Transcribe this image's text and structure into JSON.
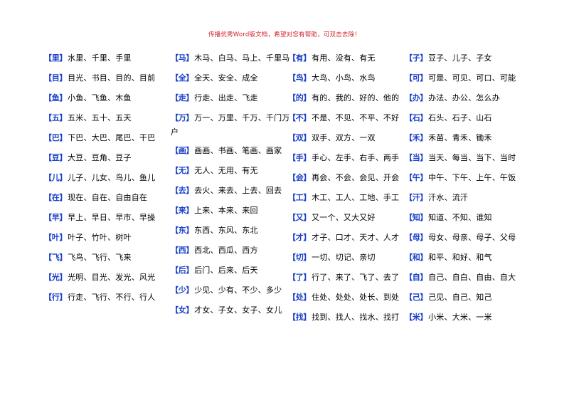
{
  "header": {
    "watermark_text": "传播优秀Word版文档，希望对您有帮助，可双击去除！",
    "watermark_color": "#d2232a"
  },
  "theme": {
    "headword_color": "#1a40c8",
    "body_text_color": "#000000",
    "background_color": "#ffffff"
  },
  "columns": [
    {
      "index": 0,
      "entries": [
        {
          "headword": "【里】",
          "words": "水里、千里、手里"
        },
        {
          "headword": "【目】",
          "words": "目光、书目、目的、目前"
        },
        {
          "headword": "【鱼】",
          "words": "小鱼、飞鱼、木鱼"
        },
        {
          "headword": "【五】",
          "words": "五米、五十、五天"
        },
        {
          "headword": "【巴】",
          "words": "下巴、大巴、尾巴、干巴"
        },
        {
          "headword": "【豆】",
          "words": "大豆、豆角、豆子"
        },
        {
          "headword": "【儿】",
          "words": "儿子、儿女、鸟儿、鱼儿"
        },
        {
          "headword": "【在】",
          "words": "现在、自在、自由自在"
        },
        {
          "headword": "【早】",
          "words": "早上、早日、早市、早操"
        },
        {
          "headword": "【叶】",
          "words": "叶子、竹叶、树叶"
        },
        {
          "headword": "【飞】",
          "words": "飞鸟、飞行、飞来"
        },
        {
          "headword": "【光】",
          "words": "光明、目光、发光、风光"
        },
        {
          "headword": "【行】",
          "words": "行走、飞行、不行、行人"
        }
      ]
    },
    {
      "index": 1,
      "entries": [
        {
          "headword": "【马】",
          "words": "木马、白马、马上、千里马"
        },
        {
          "headword": "【全】",
          "words": "全天、安全、成全"
        },
        {
          "headword": "【走】",
          "words": "行走、出走、飞走"
        },
        {
          "headword": "【万】",
          "words": "万一、万里、千万、千门万户",
          "wrap": true
        },
        {
          "headword": "【画】",
          "words": "画画、书画、笔画、画家"
        },
        {
          "headword": "【无】",
          "words": "无人、无用、有无"
        },
        {
          "headword": "【去】",
          "words": "去火、来去、上去、回去"
        },
        {
          "headword": "【来】",
          "words": "上来、本来、来回"
        },
        {
          "headword": "【东】",
          "words": "东西、东风、东北"
        },
        {
          "headword": "【西】",
          "words": "西北、西瓜、西方"
        },
        {
          "headword": "【后】",
          "words": "后门、后来、后天"
        },
        {
          "headword": "【少】",
          "words": "少见、少有、不少、多少"
        },
        {
          "headword": "【女】",
          "words": "才女、子女、女子、女儿"
        }
      ]
    },
    {
      "index": 2,
      "entries": [
        {
          "headword": "【有】",
          "words": "有用、没有、有无"
        },
        {
          "headword": "【鸟】",
          "words": "大鸟、小鸟、水鸟"
        },
        {
          "headword": "【的】",
          "words": "有的、我的、好的、他的"
        },
        {
          "headword": "【不】",
          "words": "不是、不见、不平、不好"
        },
        {
          "headword": "【双】",
          "words": "双手、双方、一双"
        },
        {
          "headword": "【手】",
          "words": "手心、左手、右手、两手"
        },
        {
          "headword": "【会】",
          "words": "再会、不会、会见、开会"
        },
        {
          "headword": "【工】",
          "words": "木工、工人、工地、手工"
        },
        {
          "headword": "【又】",
          "words": "又一个、又大又好"
        },
        {
          "headword": "【才】",
          "words": "才子、口才、天才、人才"
        },
        {
          "headword": "【切】",
          "words": "一切、切记、亲切"
        },
        {
          "headword": "【了】",
          "words": "行了、来了、飞了、去了"
        },
        {
          "headword": "【处】",
          "words": "住处、处处、处长、到处"
        },
        {
          "headword": "【找】",
          "words": "找到、找人、找水、找打"
        }
      ]
    },
    {
      "index": 3,
      "entries": [
        {
          "headword": "【子】",
          "words": "豆子、儿子、子女"
        },
        {
          "headword": "【可】",
          "words": "可是、可见、可口、可能"
        },
        {
          "headword": "【办】",
          "words": "办法、办公、怎么办"
        },
        {
          "headword": "【石】",
          "words": "石头、石子、山石"
        },
        {
          "headword": "【禾】",
          "words": "禾苗、青禾、锄禾"
        },
        {
          "headword": "【当】",
          "words": "当天、每当、当下、当时"
        },
        {
          "headword": "【午】",
          "words": "中午、下午、上午、午饭"
        },
        {
          "headword": "【汗】",
          "words": "汗水、流汗"
        },
        {
          "headword": "【知】",
          "words": "知道、不知、谁知"
        },
        {
          "headword": "【母】",
          "words": "母女、母亲、母子、父母"
        },
        {
          "headword": "【和】",
          "words": "和平、和好、和气"
        },
        {
          "headword": "【自】",
          "words": "自己、自白、自由、自大"
        },
        {
          "headword": "【己】",
          "words": "己见、自己、知己"
        },
        {
          "headword": "【米】",
          "words": "小米、大米、一米"
        }
      ]
    }
  ]
}
